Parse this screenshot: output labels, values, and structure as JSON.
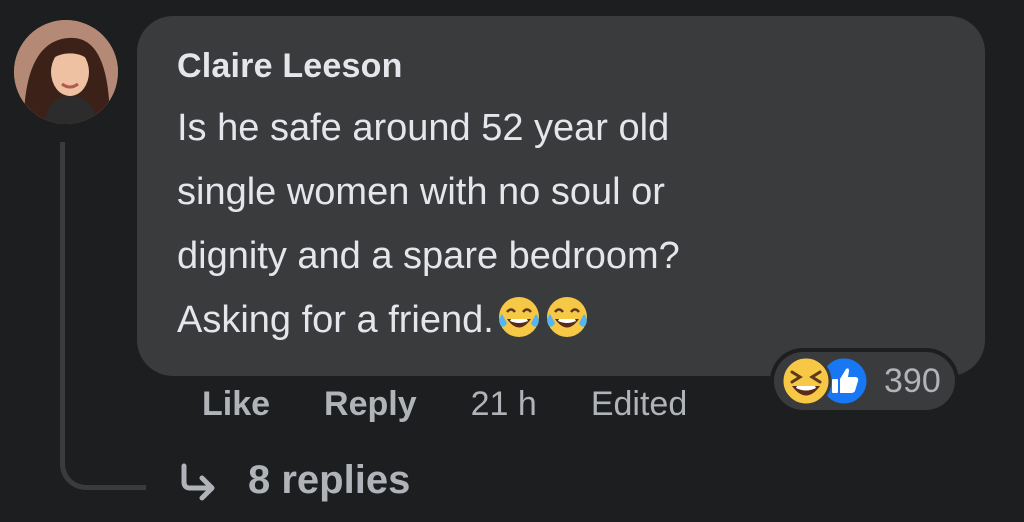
{
  "comment": {
    "author": "Claire Leeson",
    "text_lines": [
      "Is he safe around 52 year old",
      "single women with no soul or",
      "dignity and a spare bedroom?",
      "Asking for a friend."
    ],
    "emoji": [
      "laugh-cry-emoji",
      "laugh-cry-emoji"
    ]
  },
  "actions": {
    "like_label": "Like",
    "reply_label": "Reply",
    "timestamp": "21 h",
    "edited_label": "Edited"
  },
  "reactions": {
    "icons": [
      "haha-reaction-icon",
      "like-reaction-icon"
    ],
    "count": "390"
  },
  "replies": {
    "label": "8 replies",
    "icon": "reply-arrow-icon"
  },
  "colors": {
    "background": "#1d1e20",
    "bubble": "#3a3b3d",
    "text": "#e4e6eb",
    "secondary_text": "#b0b3b8",
    "like_blue": "#1877f2"
  }
}
